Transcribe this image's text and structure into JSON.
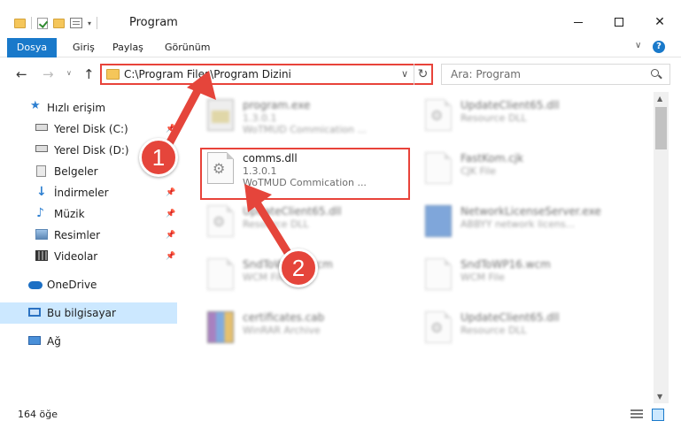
{
  "window": {
    "title": "Program"
  },
  "ribbon": {
    "tabs": [
      {
        "label": "Dosya"
      },
      {
        "label": "Giriş"
      },
      {
        "label": "Paylaş"
      },
      {
        "label": "Görünüm"
      }
    ]
  },
  "address": {
    "path": "C:\\Program Files\\Program Dizini"
  },
  "search": {
    "placeholder": "Ara: Program"
  },
  "nav": {
    "items": [
      {
        "label": "Hızlı erişim",
        "icon": "star-icon"
      },
      {
        "label": "Yerel Disk (C:)",
        "icon": "drive-icon"
      },
      {
        "label": "Yerel Disk (D:)",
        "icon": "drive-icon"
      },
      {
        "label": "Belgeler",
        "icon": "documents-icon"
      },
      {
        "label": "İndirmeler",
        "icon": "download-icon"
      },
      {
        "label": "Müzik",
        "icon": "music-icon"
      },
      {
        "label": "Resimler",
        "icon": "pictures-icon"
      },
      {
        "label": "Videolar",
        "icon": "videos-icon"
      },
      {
        "label": "OneDrive",
        "icon": "cloud-icon"
      },
      {
        "label": "Bu bilgisayar",
        "icon": "computer-icon"
      },
      {
        "label": "Ağ",
        "icon": "network-icon"
      }
    ]
  },
  "files": [
    {
      "name": "program.exe",
      "line1": "1.3.0.1",
      "line2": "WoTMUD Commication ...",
      "icon": "exe-icon"
    },
    {
      "name": "UpdateClient65.dll",
      "line1": "Resource DLL",
      "line2": "",
      "icon": "dll-icon"
    },
    {
      "name": "comms.dll",
      "line1": "1.3.0.1",
      "line2": "WoTMUD Commication ...",
      "icon": "dll-icon"
    },
    {
      "name": "FastKom.cjk",
      "line1": "CJK File",
      "line2": "",
      "icon": "file-icon"
    },
    {
      "name": "UpdateClient65.dll",
      "line1": "Resource DLL",
      "line2": "",
      "icon": "dll-icon"
    },
    {
      "name": "NetworkLicenseServer.exe",
      "line1": "ABBYY network licens...",
      "line2": "",
      "icon": "app-icon"
    },
    {
      "name": "SndToWP16.wcm",
      "line1": "WCM File",
      "line2": "",
      "icon": "file-icon"
    },
    {
      "name": "SndToWP16.wcm",
      "line1": "WCM File",
      "line2": "",
      "icon": "file-icon"
    },
    {
      "name": "certificates.cab",
      "line1": "WinRAR Archive",
      "line2": "",
      "icon": "archive-icon"
    },
    {
      "name": "UpdateClient65.dll",
      "line1": "Resource DLL",
      "line2": "",
      "icon": "dll-icon"
    }
  ],
  "annotations": {
    "badge1": "1",
    "badge2": "2",
    "color": "#e5453b"
  },
  "status": {
    "count": "164 öğe"
  }
}
